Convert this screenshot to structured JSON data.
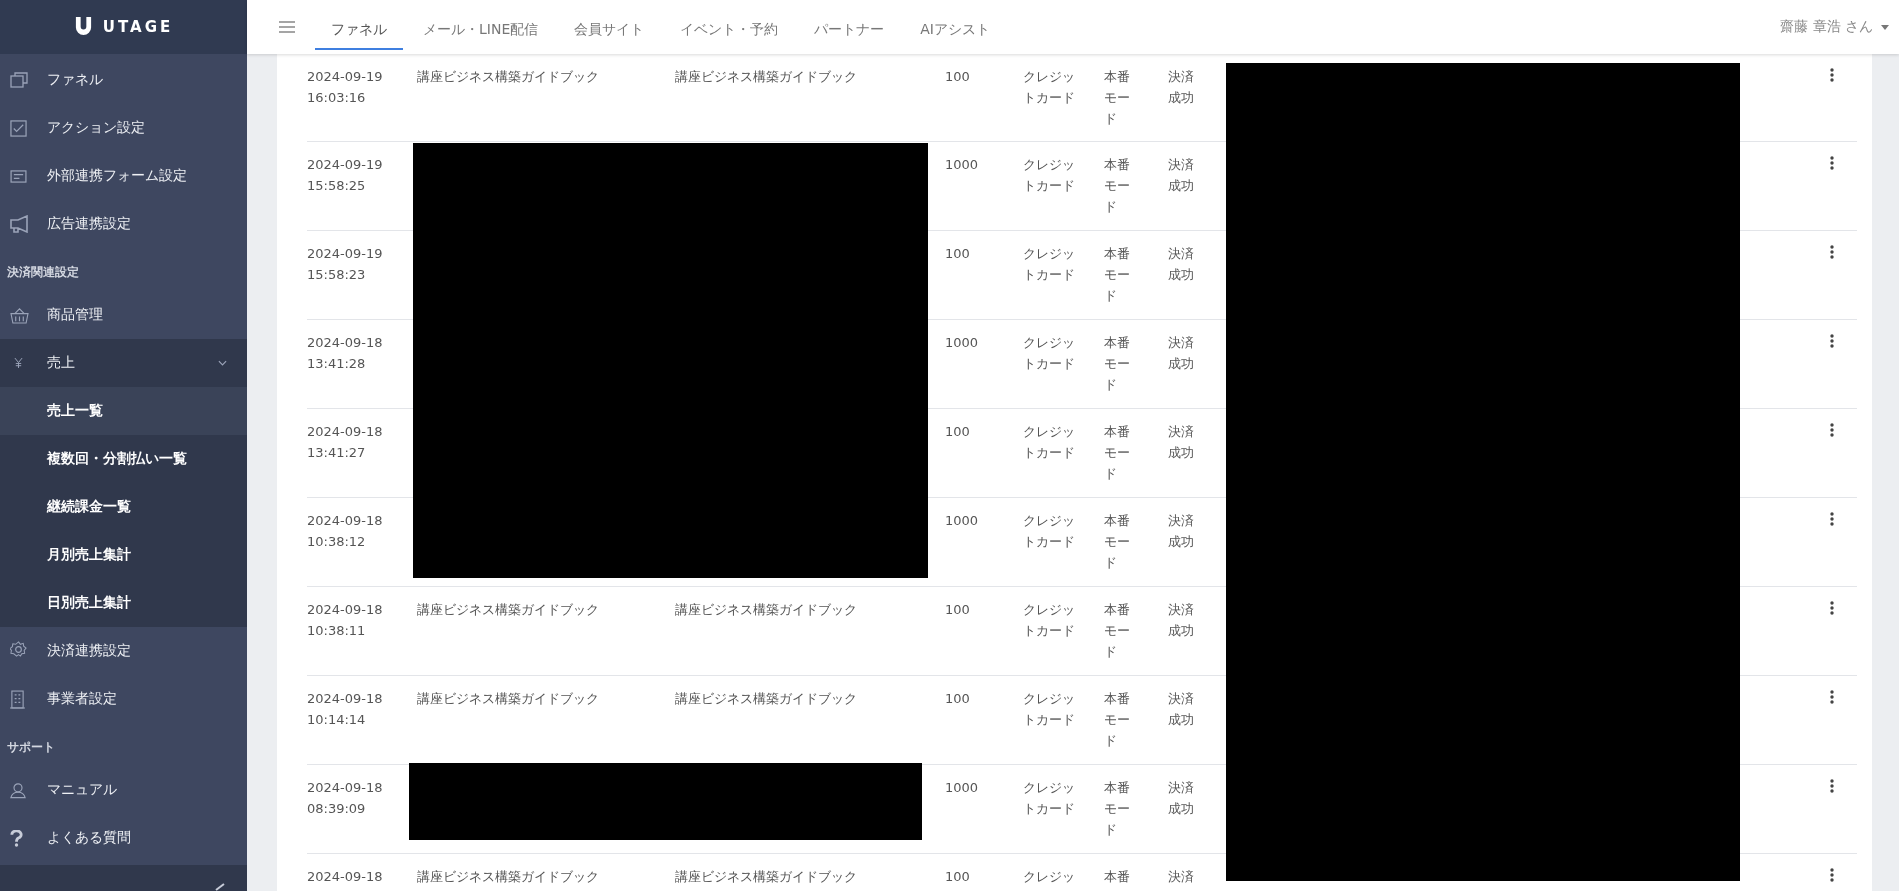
{
  "logo": {
    "text": "UTAGE"
  },
  "sidebar": {
    "items": [
      {
        "kind": "item",
        "label": "ファネル"
      },
      {
        "kind": "item",
        "label": "アクション設定"
      },
      {
        "kind": "item",
        "label": "外部連携フォーム設定"
      },
      {
        "kind": "item",
        "label": "広告連携設定"
      },
      {
        "kind": "header",
        "label": "決済関連設定"
      },
      {
        "kind": "item",
        "label": "商品管理"
      },
      {
        "kind": "group",
        "label": "売上",
        "expanded": true,
        "children": [
          {
            "label": "売上一覧",
            "selected": true
          },
          {
            "label": "複数回・分割払い一覧",
            "selected": false
          },
          {
            "label": "継続課金一覧",
            "selected": false
          },
          {
            "label": "月別売上集計",
            "selected": false
          },
          {
            "label": "日別売上集計",
            "selected": false
          }
        ]
      },
      {
        "kind": "item",
        "label": "決済連携設定"
      },
      {
        "kind": "item",
        "label": "事業者設定"
      },
      {
        "kind": "header",
        "label": "サポート"
      },
      {
        "kind": "item",
        "label": "マニュアル"
      },
      {
        "kind": "item",
        "label": "よくある質問"
      }
    ]
  },
  "topbar": {
    "tabs": [
      {
        "label": "ファネル",
        "selected": true
      },
      {
        "label": "メール・LINE配信",
        "selected": false
      },
      {
        "label": "会員サイト",
        "selected": false
      },
      {
        "label": "イベント・予約",
        "selected": false
      },
      {
        "label": "パートナー",
        "selected": false
      },
      {
        "label": "AIアシスト",
        "selected": false
      }
    ],
    "user": "齋藤 章浩 さん"
  },
  "table": {
    "rows": [
      {
        "date": "2024-09-19",
        "time": "16:03:16",
        "product": "講座ビジネス構築ガイドブック",
        "plan": "講座ビジネス構築ガイドブック",
        "amount": "100",
        "method": "クレジットカード",
        "mode": "本番モード",
        "status": "決済成功"
      },
      {
        "date": "2024-09-19",
        "time": "15:58:25",
        "amount": "1000",
        "method": "クレジットカード",
        "mode": "本番モード",
        "status": "決済成功"
      },
      {
        "date": "2024-09-19",
        "time": "15:58:23",
        "amount": "100",
        "method": "クレジットカード",
        "mode": "本番モード",
        "status": "決済成功"
      },
      {
        "date": "2024-09-18",
        "time": "13:41:28",
        "amount": "1000",
        "method": "クレジットカード",
        "mode": "本番モード",
        "status": "決済成功"
      },
      {
        "date": "2024-09-18",
        "time": "13:41:27",
        "amount": "100",
        "method": "クレジットカード",
        "mode": "本番モード",
        "status": "決済成功"
      },
      {
        "date": "2024-09-18",
        "time": "10:38:12",
        "amount": "1000",
        "method": "クレジットカード",
        "mode": "本番モード",
        "status": "決済成功"
      },
      {
        "date": "2024-09-18",
        "time": "10:38:11",
        "product": "講座ビジネス構築ガイドブック",
        "plan": "講座ビジネス構築ガイドブック",
        "amount": "100",
        "method": "クレジットカード",
        "mode": "本番モード",
        "status": "決済成功"
      },
      {
        "date": "2024-09-18",
        "time": "10:14:14",
        "product": "講座ビジネス構築ガイドブック",
        "plan": "講座ビジネス構築ガイドブック",
        "amount": "100",
        "method": "クレジットカード",
        "mode": "本番モード",
        "status": "決済成功"
      },
      {
        "date": "2024-09-18",
        "time": "08:39:09",
        "amount": "1000",
        "method": "クレジットカード",
        "mode": "本番モード",
        "status": "決済成功"
      },
      {
        "date": "2024-09-18",
        "product": "講座ビジネス構築ガイドブック",
        "plan": "講座ビジネス構築ガイドブック",
        "amount": "100",
        "method": "クレジッ",
        "mode": "本番",
        "status": "決済"
      }
    ]
  }
}
